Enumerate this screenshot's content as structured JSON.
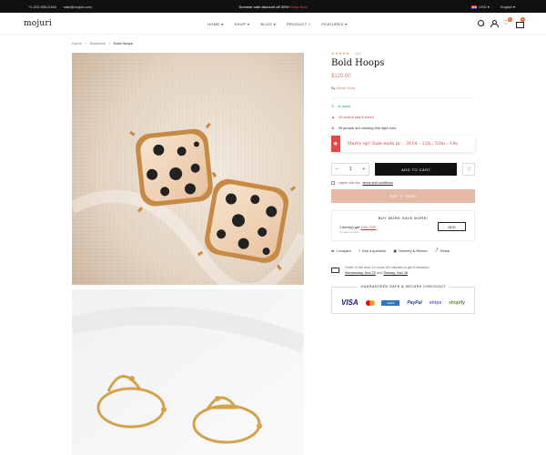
{
  "topbar": {
    "phone": "+1-202-555-0184",
    "email": "sale@mojuri.com",
    "promo": "Summer sale discount off 30%!",
    "promo_link": "Shop Now",
    "currency": "USD",
    "language": "English"
  },
  "header": {
    "logo": "mojuri",
    "nav": [
      "HOME",
      "SHOP",
      "BLOG",
      "PRODUCT",
      "FEATURED"
    ],
    "active_nav": "PRODUCT",
    "wishlist_count": "0",
    "cart_count": "1"
  },
  "breadcrumb": [
    "Home",
    "Bracelets",
    "Bold Hoops"
  ],
  "product": {
    "rating_stars": "★★★★★",
    "review_count": "(1)",
    "title": "Bold Hoops",
    "price": "$120.00",
    "by_label": "By",
    "vendor": "Made Store",
    "stock": "In stock",
    "sold": "26 sold in last 8 hours",
    "viewing": "35 people are viewing this right now",
    "hurry_label": "Hurry up! Sale ends in :",
    "countdown": "311d : 12h : 53m : 14s",
    "quantity": "1",
    "add_to_cart": "ADD TO CART",
    "terms_prefix": "I agree with the",
    "terms_link": "terms and conditions",
    "buy_now": "BUY IT NOW"
  },
  "bundle": {
    "heading": "BUY MORE SAVE MORE!",
    "offer_prefix": "1 item(s) get",
    "offer_discount": "10% OFF",
    "offer_sub": "on each product",
    "add_label": "ADD"
  },
  "actions": [
    "Compare",
    "Ask a question",
    "Delivery & Return",
    "Share"
  ],
  "delivery": {
    "line1": "Order in the next 12 hours 53 minutes to get it between",
    "date1": "Wednesday, Nov 22",
    "and": "and",
    "date2": "Sunday, Nov 26"
  },
  "checkout": {
    "heading": "GUARANTEED SAFE & SECURE CHECKOUT",
    "methods": [
      "VISA",
      "mastercard",
      "AMERICAN EXPRESS",
      "PayPal",
      "stripe",
      "shopify"
    ]
  },
  "colors": {
    "accent": "#d0826c",
    "buy_now_bg": "#e6b9a7",
    "sale_red": "#e34848",
    "in_stock_green": "#2a9a5a"
  }
}
